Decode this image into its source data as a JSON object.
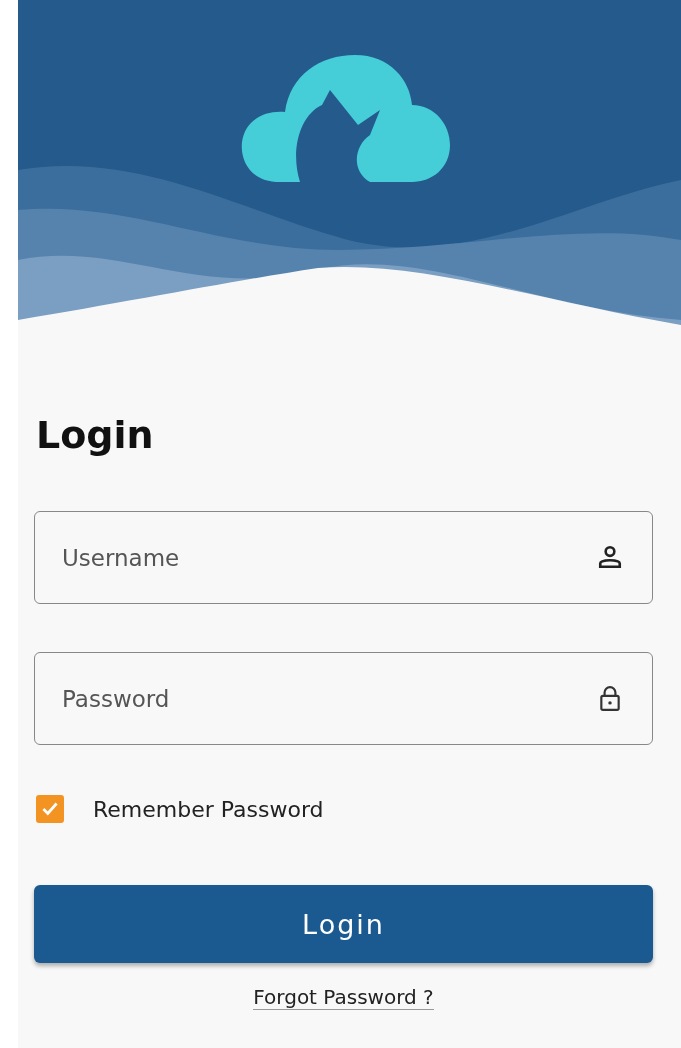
{
  "title": "Login",
  "fields": [
    {
      "kind": "user",
      "placeholder": "Username"
    },
    {
      "kind": "lock",
      "placeholder": "Password"
    }
  ],
  "remember": {
    "label": "Remember Password",
    "checked": true
  },
  "login_button": "Login",
  "forgot_link": "Forgot Password ?"
}
